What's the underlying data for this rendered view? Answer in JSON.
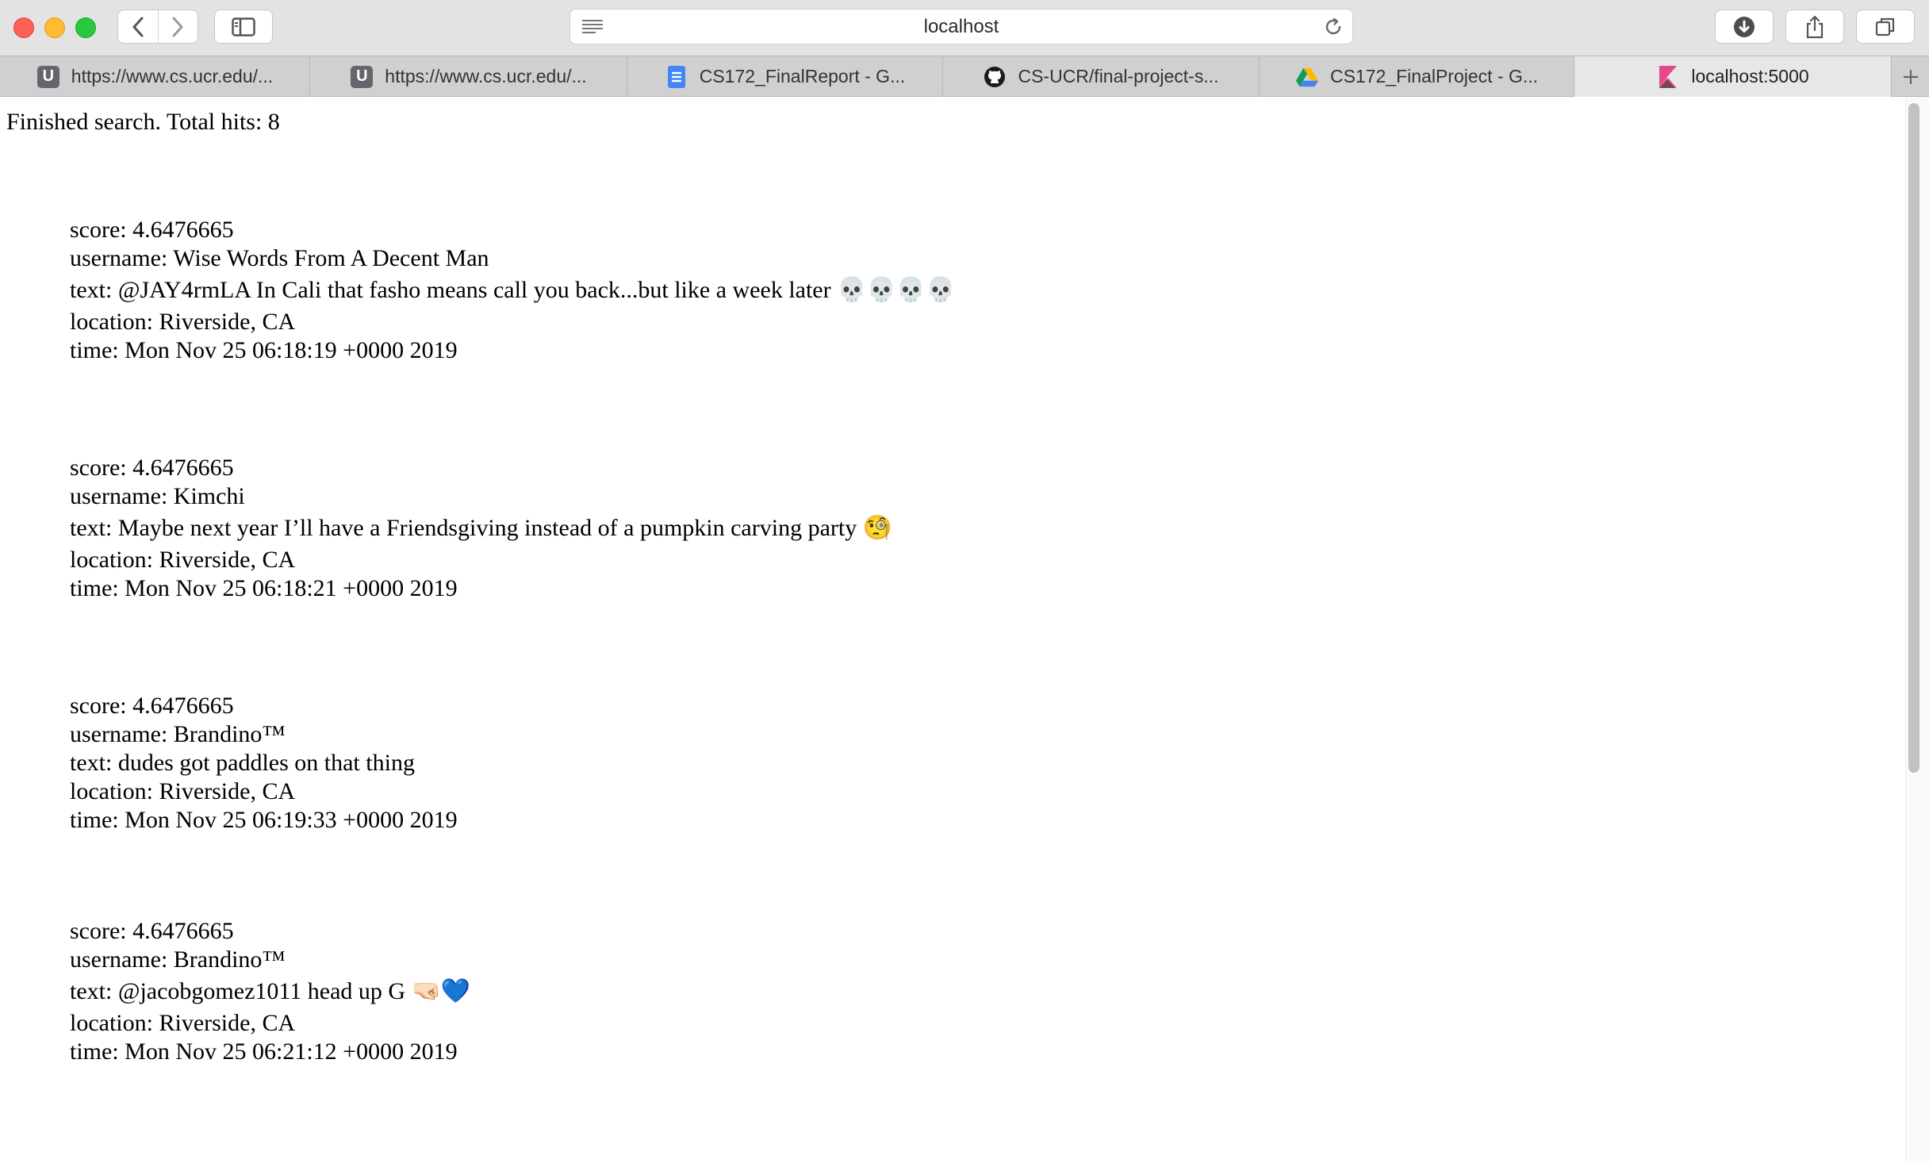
{
  "browser": {
    "address": "localhost",
    "tabs": [
      {
        "label": "https://www.cs.ucr.edu/...",
        "icon": "ucr-favicon-icon",
        "active": false
      },
      {
        "label": "https://www.cs.ucr.edu/...",
        "icon": "ucr-favicon-icon",
        "active": false
      },
      {
        "label": "CS172_FinalReport - G...",
        "icon": "google-docs-icon",
        "active": false
      },
      {
        "label": "CS-UCR/final-project-s...",
        "icon": "github-icon",
        "active": false
      },
      {
        "label": "CS172_FinalProject - G...",
        "icon": "google-drive-icon",
        "active": false
      },
      {
        "label": "localhost:5000",
        "icon": "kibana-icon",
        "active": true
      }
    ],
    "favicon_letter": "U"
  },
  "page": {
    "status": "Finished search. Total hits: 8",
    "results": [
      {
        "score": "score: 4.6476665",
        "username": "username: Wise Words From A Decent Man",
        "text": "text: @JAY4rmLA In Cali that fasho means call you back...but like a week later ",
        "emoji": "💀💀💀💀",
        "location": "location: Riverside, CA",
        "time": "time: Mon Nov 25 06:18:19 +0000 2019"
      },
      {
        "score": "score: 4.6476665",
        "username": "username: Kimchi",
        "text": "text: Maybe next year I’ll have a Friendsgiving instead of a pumpkin carving party ",
        "emoji": "🧐",
        "location": "location: Riverside, CA",
        "time": "time: Mon Nov 25 06:18:21 +0000 2019"
      },
      {
        "score": "score: 4.6476665",
        "username": "username: Brandino™",
        "text": "text: dudes got paddles on that thing",
        "emoji": "",
        "location": "location: Riverside, CA",
        "time": "time: Mon Nov 25 06:19:33 +0000 2019"
      },
      {
        "score": "score: 4.6476665",
        "username": "username: Brandino™",
        "text": "text: @jacobgomez1011 head up G ",
        "emoji": "🤜🏻💙",
        "location": "location: Riverside, CA",
        "time": "time: Mon Nov 25 06:21:12 +0000 2019"
      }
    ]
  },
  "colors": {
    "close": "#fe5f57",
    "minimize": "#febc2e",
    "zoom": "#28c840",
    "docs_blue": "#4285f4",
    "kibana_pink": "#e8478b"
  }
}
